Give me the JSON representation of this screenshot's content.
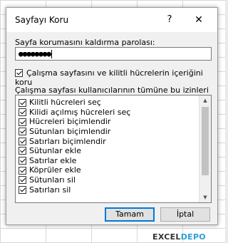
{
  "dialog": {
    "title": "Sayfayı Koru",
    "help_glyph": "?",
    "close_glyph": "✕",
    "password_label": "Sayfa korumasını kaldırma parolası:",
    "password_value": "●●●●●●●●",
    "protect_label": "Çalışma sayfasını ve kilitli hücrelerin içeriğini koru",
    "protect_checked": true,
    "permissions_label": "Çalışma sayfası kullanıcılarının tümüne bu izinleri ver:",
    "permissions": [
      {
        "label": "Kilitli hücreleri seç",
        "checked": true
      },
      {
        "label": "Kilidi açılmış hücreleri seç",
        "checked": true
      },
      {
        "label": "Hücreleri biçimlendir",
        "checked": true
      },
      {
        "label": "Sütunları biçimlendir",
        "checked": true
      },
      {
        "label": "Satırları biçimlendir",
        "checked": true
      },
      {
        "label": "Sütunlar ekle",
        "checked": true
      },
      {
        "label": "Satırlar ekle",
        "checked": true
      },
      {
        "label": "Köprüler ekle",
        "checked": true
      },
      {
        "label": "Sütunları sil",
        "checked": true
      },
      {
        "label": "Satırları sil",
        "checked": true
      }
    ],
    "ok_label": "Tamam",
    "cancel_label": "İptal"
  },
  "watermark": {
    "part1": "EXCEL",
    "part2": "DEPO"
  },
  "colors": {
    "accent": "#0078d7",
    "dialog_bg": "#f0f0f0",
    "watermark_blue": "#2a9fd6"
  }
}
